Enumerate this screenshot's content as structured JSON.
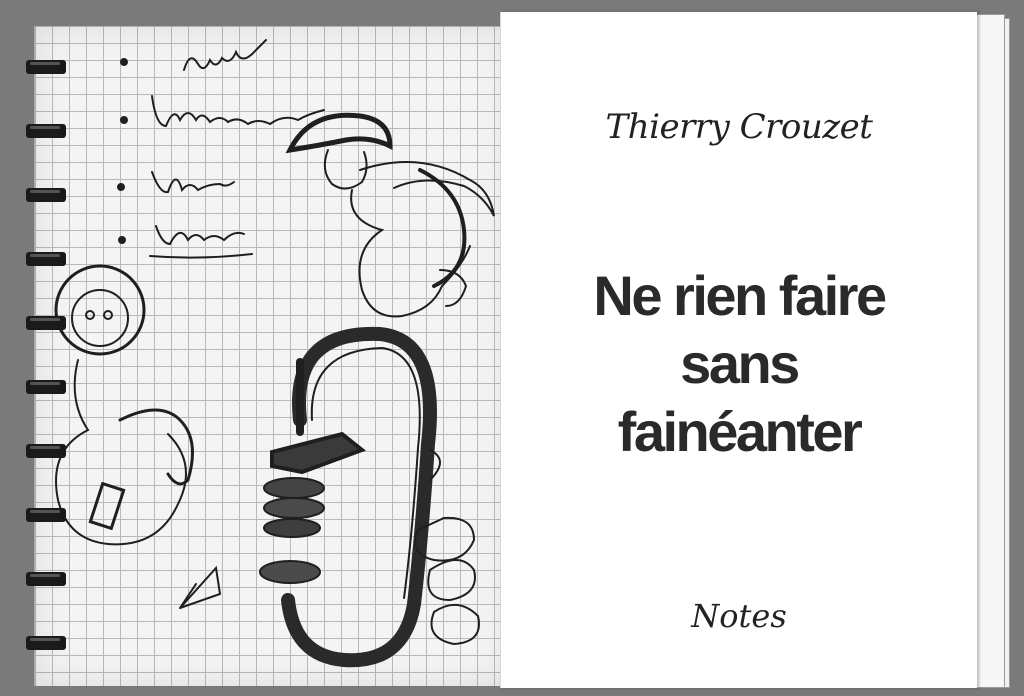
{
  "cover": {
    "author": "Thierry Crouzet",
    "title_lines": [
      "Ne rien faire",
      "sans",
      "fainéanter"
    ],
    "subtitle": "Notes"
  },
  "notebook": {
    "binding_ring_count": 10,
    "ink_color": "#1f1f1f",
    "paper_color": "#f4f4f4",
    "grid_color": "#b9b9b9"
  }
}
